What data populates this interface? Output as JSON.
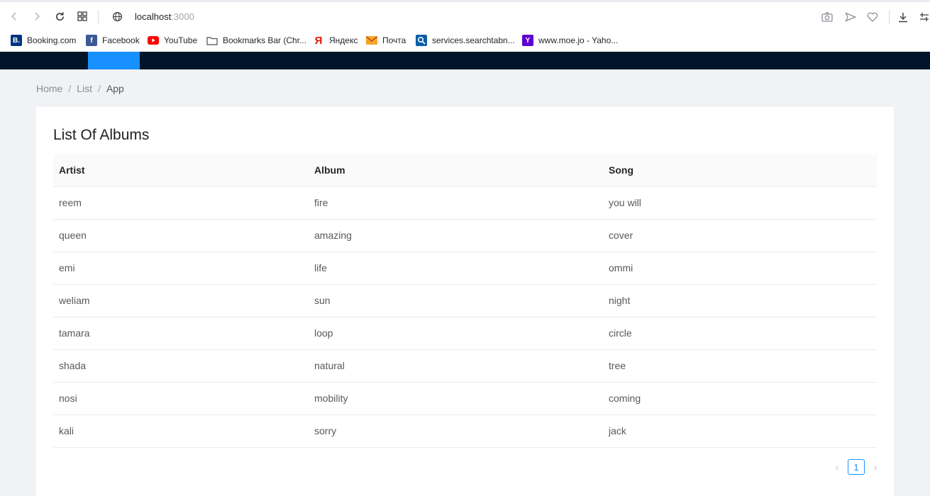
{
  "browser": {
    "url_host": "localhost",
    "url_port": ":3000",
    "bookmarks": [
      {
        "label": "Booking.com",
        "icon": "booking-icon",
        "color": "#003580"
      },
      {
        "label": "Facebook",
        "icon": "facebook-icon",
        "color": "#3b5998"
      },
      {
        "label": "YouTube",
        "icon": "youtube-icon",
        "color": "#ff0000"
      },
      {
        "label": "Bookmarks Bar (Chr...",
        "icon": "folder-icon",
        "color": "#ffffff"
      },
      {
        "label": "Яндекс",
        "icon": "yandex-icon",
        "color": "#ffffff"
      },
      {
        "label": "Почта",
        "icon": "mail-icon",
        "color": "#f5a623"
      },
      {
        "label": "services.searchtabn...",
        "icon": "search-icon",
        "color": "#0a5ea8"
      },
      {
        "label": "www.moe.jo - Yaho...",
        "icon": "yahoo-icon",
        "color": "#5f01d1"
      }
    ]
  },
  "header": {
    "colors": {
      "background": "#001529",
      "active": "#1890ff"
    }
  },
  "breadcrumb": {
    "items": [
      "Home",
      "List",
      "App"
    ],
    "separator": "/"
  },
  "card": {
    "title": "List Of Albums"
  },
  "table": {
    "headers": [
      "Artist",
      "Album",
      "Song"
    ],
    "rows": [
      [
        "reem",
        "fire",
        "you will"
      ],
      [
        "queen",
        "amazing",
        "cover"
      ],
      [
        "emi",
        "life",
        "ommi"
      ],
      [
        "weliam",
        "sun",
        "night"
      ],
      [
        "tamara",
        "loop",
        "circle"
      ],
      [
        "shada",
        "natural",
        "tree"
      ],
      [
        "nosi",
        "mobility",
        "coming"
      ],
      [
        "kali",
        "sorry",
        "jack"
      ]
    ]
  },
  "pagination": {
    "current_page": "1",
    "prev_label": "‹",
    "next_label": "›"
  }
}
